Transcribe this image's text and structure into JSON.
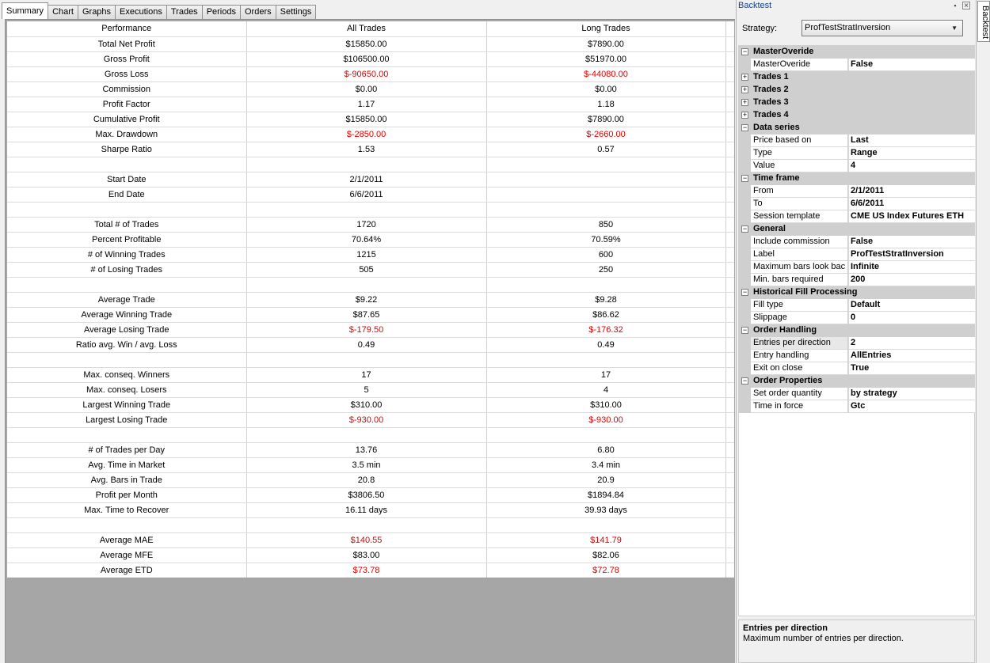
{
  "tabs": [
    "Summary",
    "Chart",
    "Graphs",
    "Executions",
    "Trades",
    "Periods",
    "Orders",
    "Settings"
  ],
  "active_tab": "Summary",
  "colors": {
    "negative": "#e00000",
    "category_bg": "#cfcfcf",
    "grid_bg": "#a6a6a6"
  },
  "performance": {
    "headers": [
      "Performance",
      "All Trades",
      "Long Trades"
    ],
    "rows": [
      [
        "Total Net Profit",
        "$15850.00",
        "$7890.00"
      ],
      [
        "Gross Profit",
        "$106500.00",
        "$51970.00"
      ],
      [
        "Gross Loss",
        "$-90650.00",
        "$-44080.00"
      ],
      [
        "Commission",
        "$0.00",
        "$0.00"
      ],
      [
        "Profit Factor",
        "1.17",
        "1.18"
      ],
      [
        "Cumulative Profit",
        "$15850.00",
        "$7890.00"
      ],
      [
        "Max. Drawdown",
        "$-2850.00",
        "$-2660.00"
      ],
      [
        "Sharpe Ratio",
        "1.53",
        "0.57"
      ],
      [
        "",
        "",
        ""
      ],
      [
        "Start Date",
        "2/1/2011",
        ""
      ],
      [
        "End Date",
        "6/6/2011",
        ""
      ],
      [
        "",
        "",
        ""
      ],
      [
        "Total # of Trades",
        "1720",
        "850"
      ],
      [
        "Percent Profitable",
        "70.64%",
        "70.59%"
      ],
      [
        "# of Winning Trades",
        "1215",
        "600"
      ],
      [
        "# of Losing Trades",
        "505",
        "250"
      ],
      [
        "",
        "",
        ""
      ],
      [
        "Average Trade",
        "$9.22",
        "$9.28"
      ],
      [
        "Average Winning Trade",
        "$87.65",
        "$86.62"
      ],
      [
        "Average Losing Trade",
        "$-179.50",
        "$-176.32"
      ],
      [
        "Ratio avg. Win / avg. Loss",
        "0.49",
        "0.49"
      ],
      [
        "",
        "",
        ""
      ],
      [
        "Max. conseq. Winners",
        "17",
        "17"
      ],
      [
        "Max. conseq. Losers",
        "5",
        "4"
      ],
      [
        "Largest Winning Trade",
        "$310.00",
        "$310.00"
      ],
      [
        "Largest Losing Trade",
        "$-930.00",
        "$-930.00"
      ],
      [
        "",
        "",
        ""
      ],
      [
        "# of Trades per Day",
        "13.76",
        "6.80"
      ],
      [
        "Avg. Time in Market",
        "3.5 min",
        "3.4 min"
      ],
      [
        "Avg. Bars in Trade",
        "20.8",
        "20.9"
      ],
      [
        "Profit per Month",
        "$3806.50",
        "$1894.84"
      ],
      [
        "Max. Time to Recover",
        "16.11 days",
        "39.93 days"
      ],
      [
        "",
        "",
        ""
      ],
      [
        "Average MAE",
        "$140.55",
        "$141.79"
      ],
      [
        "Average MFE",
        "$83.00",
        "$82.06"
      ],
      [
        "Average ETD",
        "$73.78",
        "$72.78"
      ]
    ],
    "negative_cells": [
      [
        2,
        1
      ],
      [
        2,
        2
      ],
      [
        6,
        1
      ],
      [
        6,
        2
      ],
      [
        19,
        1
      ],
      [
        19,
        2
      ],
      [
        25,
        1
      ],
      [
        25,
        2
      ],
      [
        33,
        1
      ],
      [
        33,
        2
      ],
      [
        35,
        1
      ],
      [
        35,
        2
      ]
    ]
  },
  "backtest": {
    "title": "Backtest",
    "side_tab": "Backtest",
    "strategy_label": "Strategy:",
    "strategy_value": "ProfTestStratInversion",
    "properties": [
      {
        "type": "cat",
        "name": "MasterOveride",
        "expanded": true
      },
      {
        "type": "item",
        "name": "MasterOveride",
        "value": "False"
      },
      {
        "type": "cat",
        "name": "Trades 1",
        "expanded": false
      },
      {
        "type": "cat",
        "name": "Trades 2",
        "expanded": false
      },
      {
        "type": "cat",
        "name": "Trades 3",
        "expanded": false
      },
      {
        "type": "cat",
        "name": "Trades 4",
        "expanded": false
      },
      {
        "type": "cat",
        "name": "Data series",
        "expanded": true
      },
      {
        "type": "item",
        "name": "Price based on",
        "value": "Last"
      },
      {
        "type": "item",
        "name": "Type",
        "value": "Range"
      },
      {
        "type": "item",
        "name": "Value",
        "value": "4"
      },
      {
        "type": "cat",
        "name": "Time frame",
        "expanded": true
      },
      {
        "type": "item",
        "name": "From",
        "value": "2/1/2011"
      },
      {
        "type": "item",
        "name": "To",
        "value": "6/6/2011"
      },
      {
        "type": "item",
        "name": "Session template",
        "value": "CME US Index Futures ETH"
      },
      {
        "type": "cat",
        "name": "General",
        "expanded": true
      },
      {
        "type": "item",
        "name": "Include commission",
        "value": "False"
      },
      {
        "type": "item",
        "name": "Label",
        "value": "ProfTestStratInversion"
      },
      {
        "type": "item",
        "name": "Maximum bars look bac",
        "value": "Infinite"
      },
      {
        "type": "item",
        "name": "Min. bars required",
        "value": "200"
      },
      {
        "type": "cat",
        "name": "Historical Fill Processing",
        "expanded": true
      },
      {
        "type": "item",
        "name": "Fill type",
        "value": "Default"
      },
      {
        "type": "item",
        "name": "Slippage",
        "value": "0"
      },
      {
        "type": "cat",
        "name": "Order Handling",
        "expanded": true
      },
      {
        "type": "item",
        "name": "Entries per direction",
        "value": "2",
        "selected": true
      },
      {
        "type": "item",
        "name": "Entry handling",
        "value": "AllEntries"
      },
      {
        "type": "item",
        "name": "Exit on close",
        "value": "True"
      },
      {
        "type": "cat",
        "name": "Order Properties",
        "expanded": true
      },
      {
        "type": "item",
        "name": "Set order quantity",
        "value": "by strategy"
      },
      {
        "type": "item",
        "name": "Time in force",
        "value": "Gtc"
      }
    ],
    "help_title": "Entries per direction",
    "help_text": "Maximum number of entries per direction."
  }
}
